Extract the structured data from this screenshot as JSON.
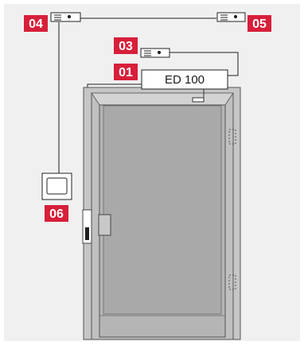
{
  "colors": {
    "background": "#f0f0f0",
    "badge": "#d71f3a",
    "door": "#b5b5b5",
    "door_panel": "#a9a9a9",
    "frame": "#c6c6c6",
    "line": "#1f1f1f"
  },
  "operator": {
    "label": "ED 100"
  },
  "badges": {
    "b01": "01",
    "b03": "03",
    "b04": "04",
    "b05": "05",
    "b06": "06"
  }
}
